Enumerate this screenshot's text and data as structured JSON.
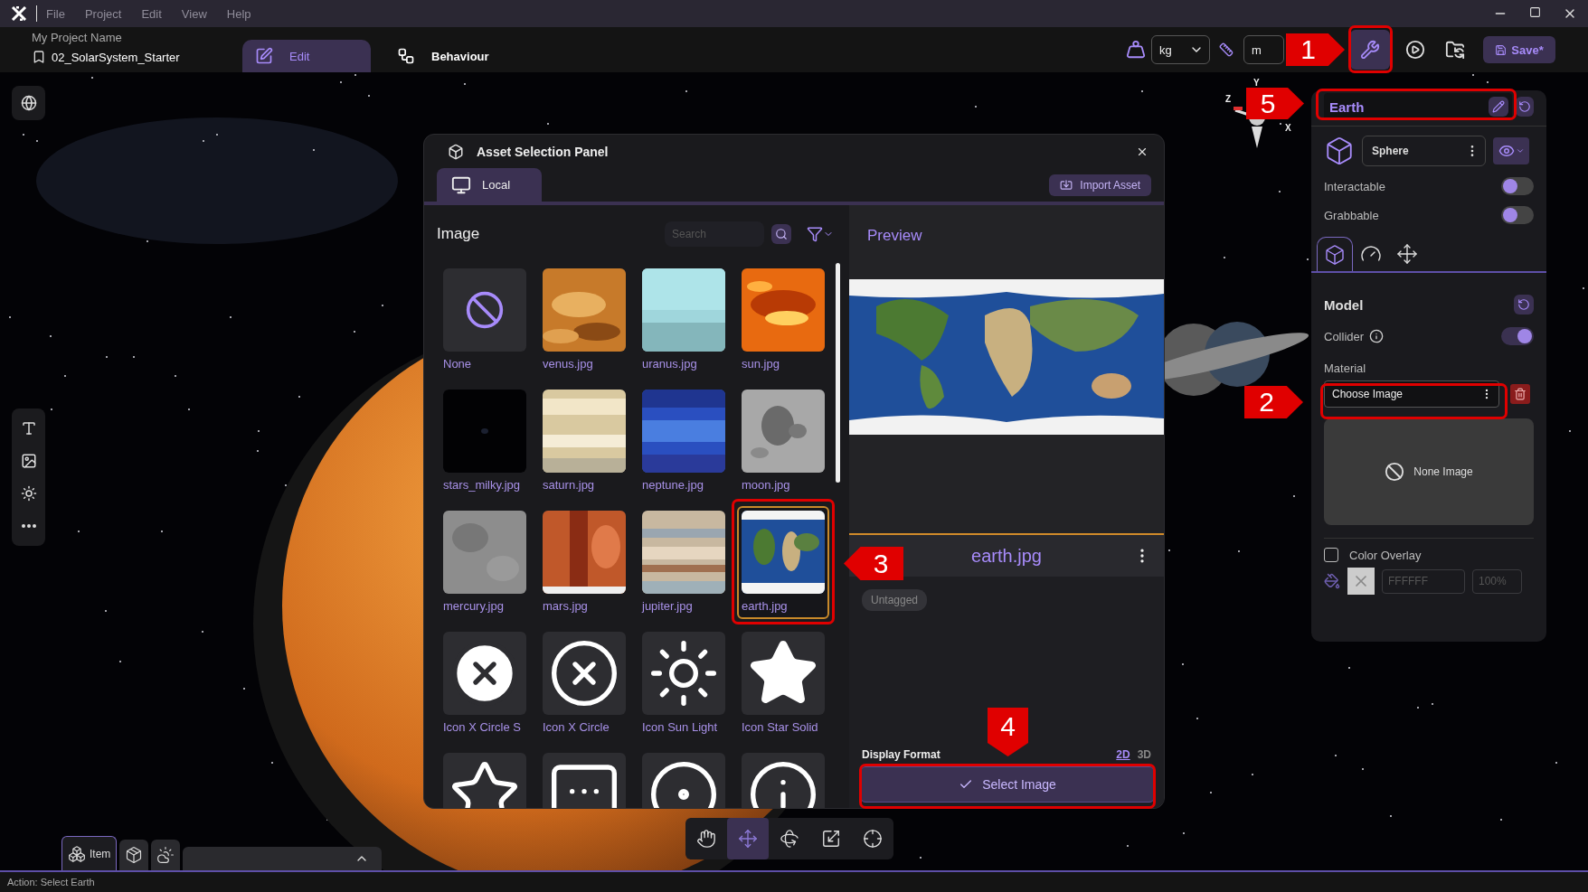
{
  "menu": [
    {
      "label": "File"
    },
    {
      "label": "Project"
    },
    {
      "label": "Edit"
    },
    {
      "label": "View"
    },
    {
      "label": "Help"
    }
  ],
  "project": {
    "name": "My Project Name",
    "scene": "02_SolarSystem_Starter"
  },
  "mode_tabs": [
    {
      "label": "Edit",
      "selected": true
    },
    {
      "label": "Behaviour",
      "selected": false
    }
  ],
  "toolbar": {
    "mass_unit": "kg",
    "length_unit": "m",
    "save_label": "Save*"
  },
  "gizmo_axes": [
    "Y",
    "Z",
    "X"
  ],
  "asset_panel": {
    "title": "Asset Selection Panel",
    "tabs": [
      {
        "label": "Local",
        "selected": true
      }
    ],
    "import_label": "Import Asset",
    "section_title": "Image",
    "search": {
      "placeholder": "Search"
    },
    "assets": [
      {
        "name": "None",
        "kind": "none",
        "selected": false
      },
      {
        "name": "venus.jpg",
        "kind": "picture",
        "selected": false
      },
      {
        "name": "uranus.jpg",
        "kind": "picture",
        "selected": false
      },
      {
        "name": "sun.jpg",
        "kind": "picture",
        "selected": false
      },
      {
        "name": "stars_milky.jpg",
        "kind": "picture",
        "selected": false
      },
      {
        "name": "saturn.jpg",
        "kind": "picture",
        "selected": false
      },
      {
        "name": "neptune.jpg",
        "kind": "picture",
        "selected": false
      },
      {
        "name": "moon.jpg",
        "kind": "picture",
        "selected": false
      },
      {
        "name": "mercury.jpg",
        "kind": "picture",
        "selected": false
      },
      {
        "name": "mars.jpg",
        "kind": "picture",
        "selected": false
      },
      {
        "name": "jupiter.jpg",
        "kind": "picture",
        "selected": false
      },
      {
        "name": "earth.jpg",
        "kind": "picture",
        "selected": true
      },
      {
        "name": "Icon X Circle S",
        "kind": "icon",
        "selected": false
      },
      {
        "name": "Icon X Circle",
        "kind": "icon",
        "selected": false
      },
      {
        "name": "Icon Sun Light",
        "kind": "icon",
        "selected": false
      },
      {
        "name": "Icon Star Solid",
        "kind": "icon",
        "selected": false
      },
      {
        "kind": "icon",
        "selected": false
      },
      {
        "kind": "icon",
        "selected": false
      },
      {
        "kind": "icon",
        "selected": false
      },
      {
        "kind": "icon",
        "selected": false
      }
    ],
    "preview": {
      "title": "Preview",
      "file_name": "earth.jpg",
      "tag": "Untagged",
      "display_format_label": "Display Format",
      "formats": [
        {
          "label": "2D",
          "selected": true
        },
        {
          "label": "3D",
          "selected": false
        }
      ],
      "select_label": "Select Image"
    }
  },
  "inspector": {
    "object_name": "Earth",
    "shape": "Sphere",
    "toggles": [
      {
        "label": "Interactable",
        "on": false
      },
      {
        "label": "Grabbable",
        "on": false
      }
    ],
    "tabs": [
      {
        "selected": true
      },
      {
        "selected": false
      },
      {
        "selected": false
      }
    ],
    "section_title": "Model",
    "collider": {
      "label": "Collider",
      "on": true
    },
    "material_label": "Material",
    "material_value": "Choose Image",
    "image_placeholder": "None Image",
    "color_overlay": {
      "label": "Color Overlay",
      "checked": false,
      "hex_placeholder": "FFFFFF",
      "opacity_placeholder": "100%"
    }
  },
  "bottom_tabs": [
    {
      "label": "Item",
      "selected": true
    },
    {
      "selected": false
    },
    {
      "selected": false
    }
  ],
  "transform_tools": [
    {
      "selected": false
    },
    {
      "selected": true
    },
    {
      "selected": false
    },
    {
      "selected": false
    },
    {
      "selected": false
    }
  ],
  "callouts": [
    {
      "label": "1"
    },
    {
      "label": "5"
    },
    {
      "label": "2"
    },
    {
      "label": "3"
    },
    {
      "label": "4"
    }
  ],
  "status_bar": "Action: Select Earth"
}
